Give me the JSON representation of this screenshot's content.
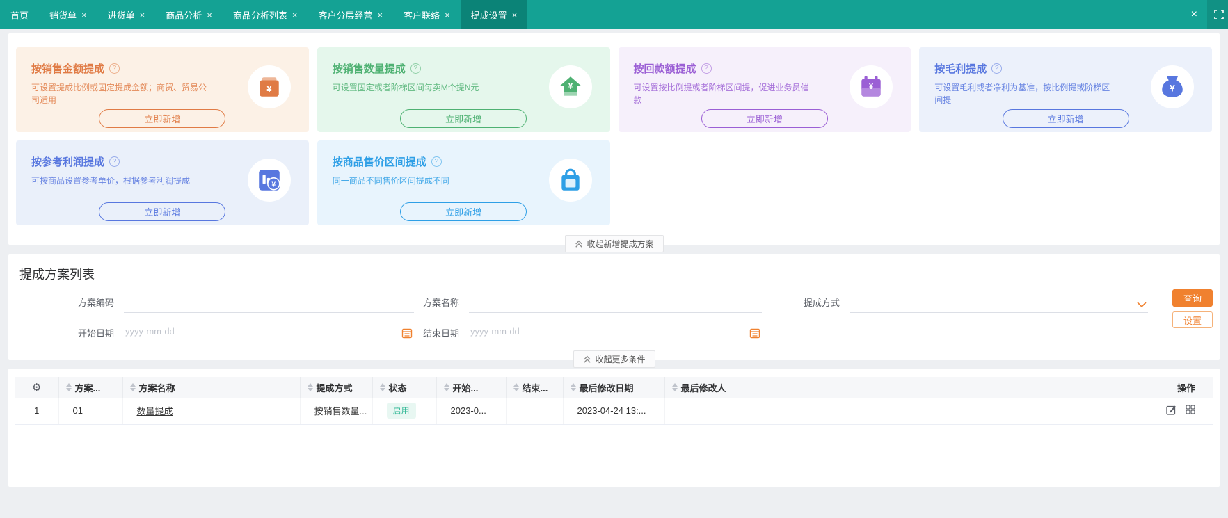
{
  "glyphs": {
    "help": "?",
    "gear": "⚙",
    "close": "×"
  },
  "tabbar": {
    "bg": "#14A294",
    "active_bg": "#0B8377",
    "close_glyph": "×",
    "tabs": [
      {
        "label": "首页",
        "closable": false,
        "active": false
      },
      {
        "label": "销货单",
        "closable": true,
        "active": false
      },
      {
        "label": "进货单",
        "closable": true,
        "active": false
      },
      {
        "label": "商品分析",
        "closable": true,
        "active": false
      },
      {
        "label": "商品分析列表",
        "closable": true,
        "active": false
      },
      {
        "label": "客户分层经营",
        "closable": true,
        "active": false
      },
      {
        "label": "客户联络",
        "closable": true,
        "active": false
      },
      {
        "label": "提成设置",
        "closable": true,
        "active": true
      }
    ]
  },
  "cards": {
    "collapse_label": "收起新增提成方案",
    "items": [
      {
        "title": "按销售金额提成",
        "desc": "可设置提成比例或固定提成金额；商贸、贸易公司适用",
        "button_label": "立即新增",
        "icon": "cashbox-yuan-icon",
        "bg": "#FCF1E6",
        "fg": "#E07B45"
      },
      {
        "title": "按销售数量提成",
        "desc": "可设置固定或者阶梯区间每卖M个提N元",
        "button_label": "立即新增",
        "icon": "arrow-up-yuan-icon",
        "bg": "#E5F7EC",
        "fg": "#4EB172"
      },
      {
        "title": "按回款额提成",
        "desc": "可设置按比例提或者阶梯区间提，促进业务员催款",
        "button_label": "立即新增",
        "icon": "calendar-yuan-icon",
        "bg": "#F6F0FB",
        "fg": "#9B5FD5"
      },
      {
        "title": "按毛利提成",
        "desc": "可设置毛利或者净利为基准，按比例提或阶梯区间提",
        "button_label": "立即新增",
        "icon": "money-bag-icon",
        "bg": "#ECF1FB",
        "fg": "#5877DF"
      },
      {
        "title": "按参考利润提成",
        "desc": "可按商品设置参考单价，根据参考利润提成",
        "button_label": "立即新增",
        "icon": "chart-yuan-icon",
        "bg": "#EAF0FA",
        "fg": "#5877DF"
      },
      {
        "title": "按商品售价区间提成",
        "desc": "同一商品不同售价区间提成不同",
        "button_label": "立即新增",
        "icon": "shopping-bag-icon",
        "bg": "#E8F4FD",
        "fg": "#2E9FE6"
      }
    ]
  },
  "filter": {
    "title": "提成方案列表",
    "accent": "#F0812F",
    "fields": {
      "code_label": "方案编码",
      "name_label": "方案名称",
      "method_label": "提成方式",
      "start_label": "开始日期",
      "end_label": "结束日期",
      "date_placeholder": "yyyy-mm-dd"
    },
    "buttons": {
      "search": "查询",
      "settings": "设置"
    },
    "collapse_label": "收起更多条件"
  },
  "table": {
    "headers": [
      "方案...",
      "方案名称",
      "提成方式",
      "状态",
      "开始...",
      "结束...",
      "最后修改日期",
      "最后修改人",
      "操作"
    ],
    "status_color": "#30B795",
    "rows": [
      {
        "index": "1",
        "code": "01",
        "name": "数量提成",
        "method": "按销售数量...",
        "status": "启用",
        "start": "2023-0...",
        "end": "",
        "modified_date": "2023-04-24 13:...",
        "modified_by_redacted": true
      }
    ]
  }
}
